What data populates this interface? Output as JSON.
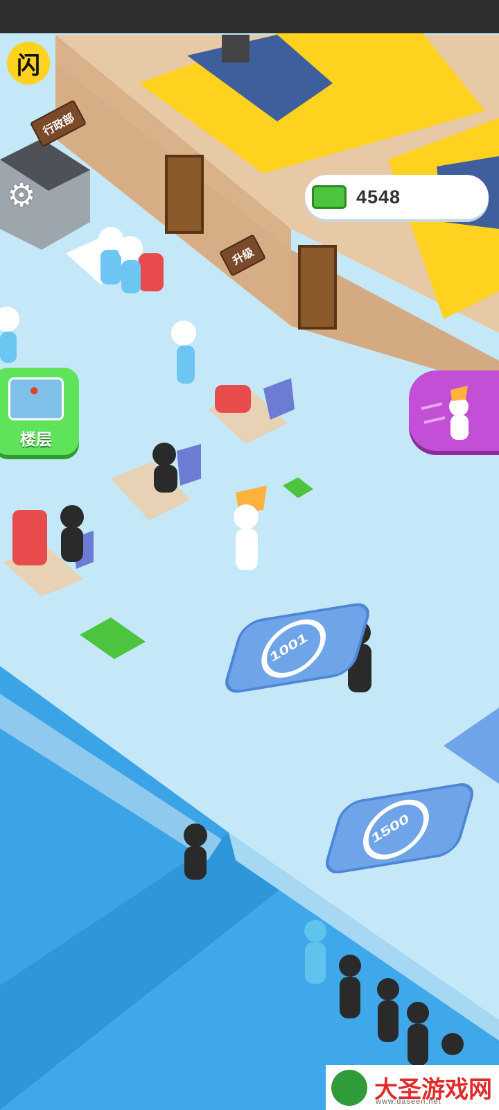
{
  "hud": {
    "logo_label": "闪",
    "cash_amount": "4548",
    "floor_button_label": "楼层"
  },
  "signs": {
    "admin_dept": "行政部",
    "upgrade": "升级"
  },
  "pads": [
    {
      "price": "1001"
    },
    {
      "price": "1500"
    }
  ],
  "watermark": {
    "title": "大圣游戏网",
    "url": "www.daseen.net"
  },
  "icons": {
    "settings": "gear-icon",
    "cash": "cash-stack-icon",
    "map": "map-pin-icon",
    "speed": "speed-boost-icon"
  }
}
